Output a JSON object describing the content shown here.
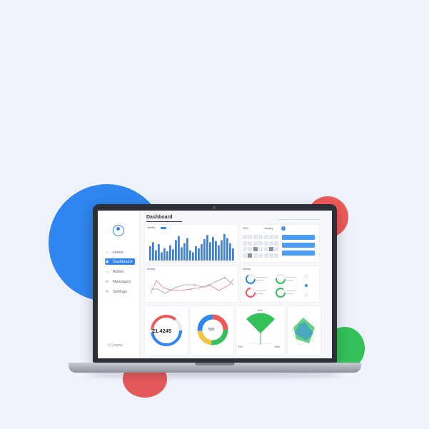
{
  "colors": {
    "accent": "#2f86ee",
    "red": "#ee5a5a",
    "green": "#34c15a",
    "yellow": "#f5c542"
  },
  "sidebar": {
    "items": [
      {
        "label": "Home",
        "icon": "home-icon"
      },
      {
        "label": "Dashboard",
        "icon": "grid-icon",
        "active": true
      },
      {
        "label": "Admin",
        "icon": "user-icon"
      },
      {
        "label": "Messages",
        "icon": "mail-icon"
      },
      {
        "label": "Settings",
        "icon": "gear-icon"
      }
    ],
    "logout": "Logout"
  },
  "header": {
    "title": "Dashboard"
  },
  "calendar": {
    "year": "2020",
    "month": "January"
  },
  "cards": {
    "activity_label": "Activity",
    "activity2_label": "Activity",
    "activity3_label": "Activity",
    "donut_value": "21.4245",
    "ring_value": "560",
    "fan_left": "21%",
    "fan_top": "50%",
    "fan_right": "50%"
  },
  "chart_data": {
    "type": "bar",
    "values": [
      14,
      18,
      10,
      16,
      8,
      12,
      9,
      15,
      11,
      20,
      24,
      13,
      17,
      22,
      10,
      8,
      14,
      12,
      16,
      21,
      25,
      18,
      23,
      19,
      15,
      20,
      26,
      22,
      17,
      12
    ]
  }
}
